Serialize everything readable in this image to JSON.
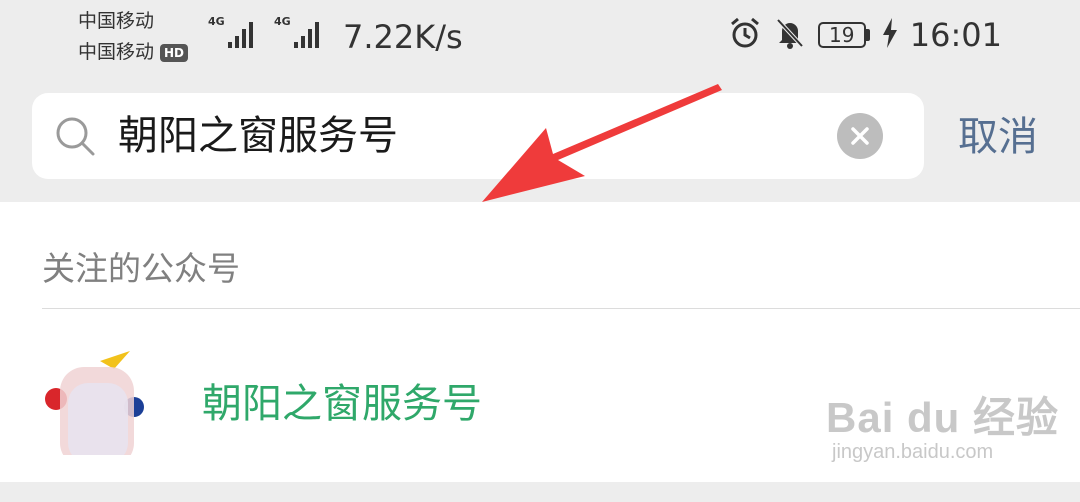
{
  "status_bar": {
    "carrier1": "中国移动",
    "carrier2": "中国移动",
    "hd_badge": "HD",
    "signal1_tag": "4G",
    "signal2_tag": "4G",
    "net_speed": "7.22K/s",
    "battery_level": "19",
    "time": "16:01",
    "icons": [
      "alarm-icon",
      "bell-off-icon",
      "battery-icon",
      "charging-icon"
    ]
  },
  "search": {
    "query": "朝阳之窗服务号",
    "cancel_label": "取消"
  },
  "results": {
    "section_header": "关注的公众号",
    "items": [
      {
        "title": "朝阳之窗服务号"
      }
    ]
  },
  "watermark": {
    "brand": "Bai du 经验",
    "url": "jingyan.baidu.com"
  },
  "colors": {
    "background": "#ededed",
    "result_title": "#2fa86a",
    "cancel": "#566f91",
    "arrow": "#ef3b3b"
  }
}
